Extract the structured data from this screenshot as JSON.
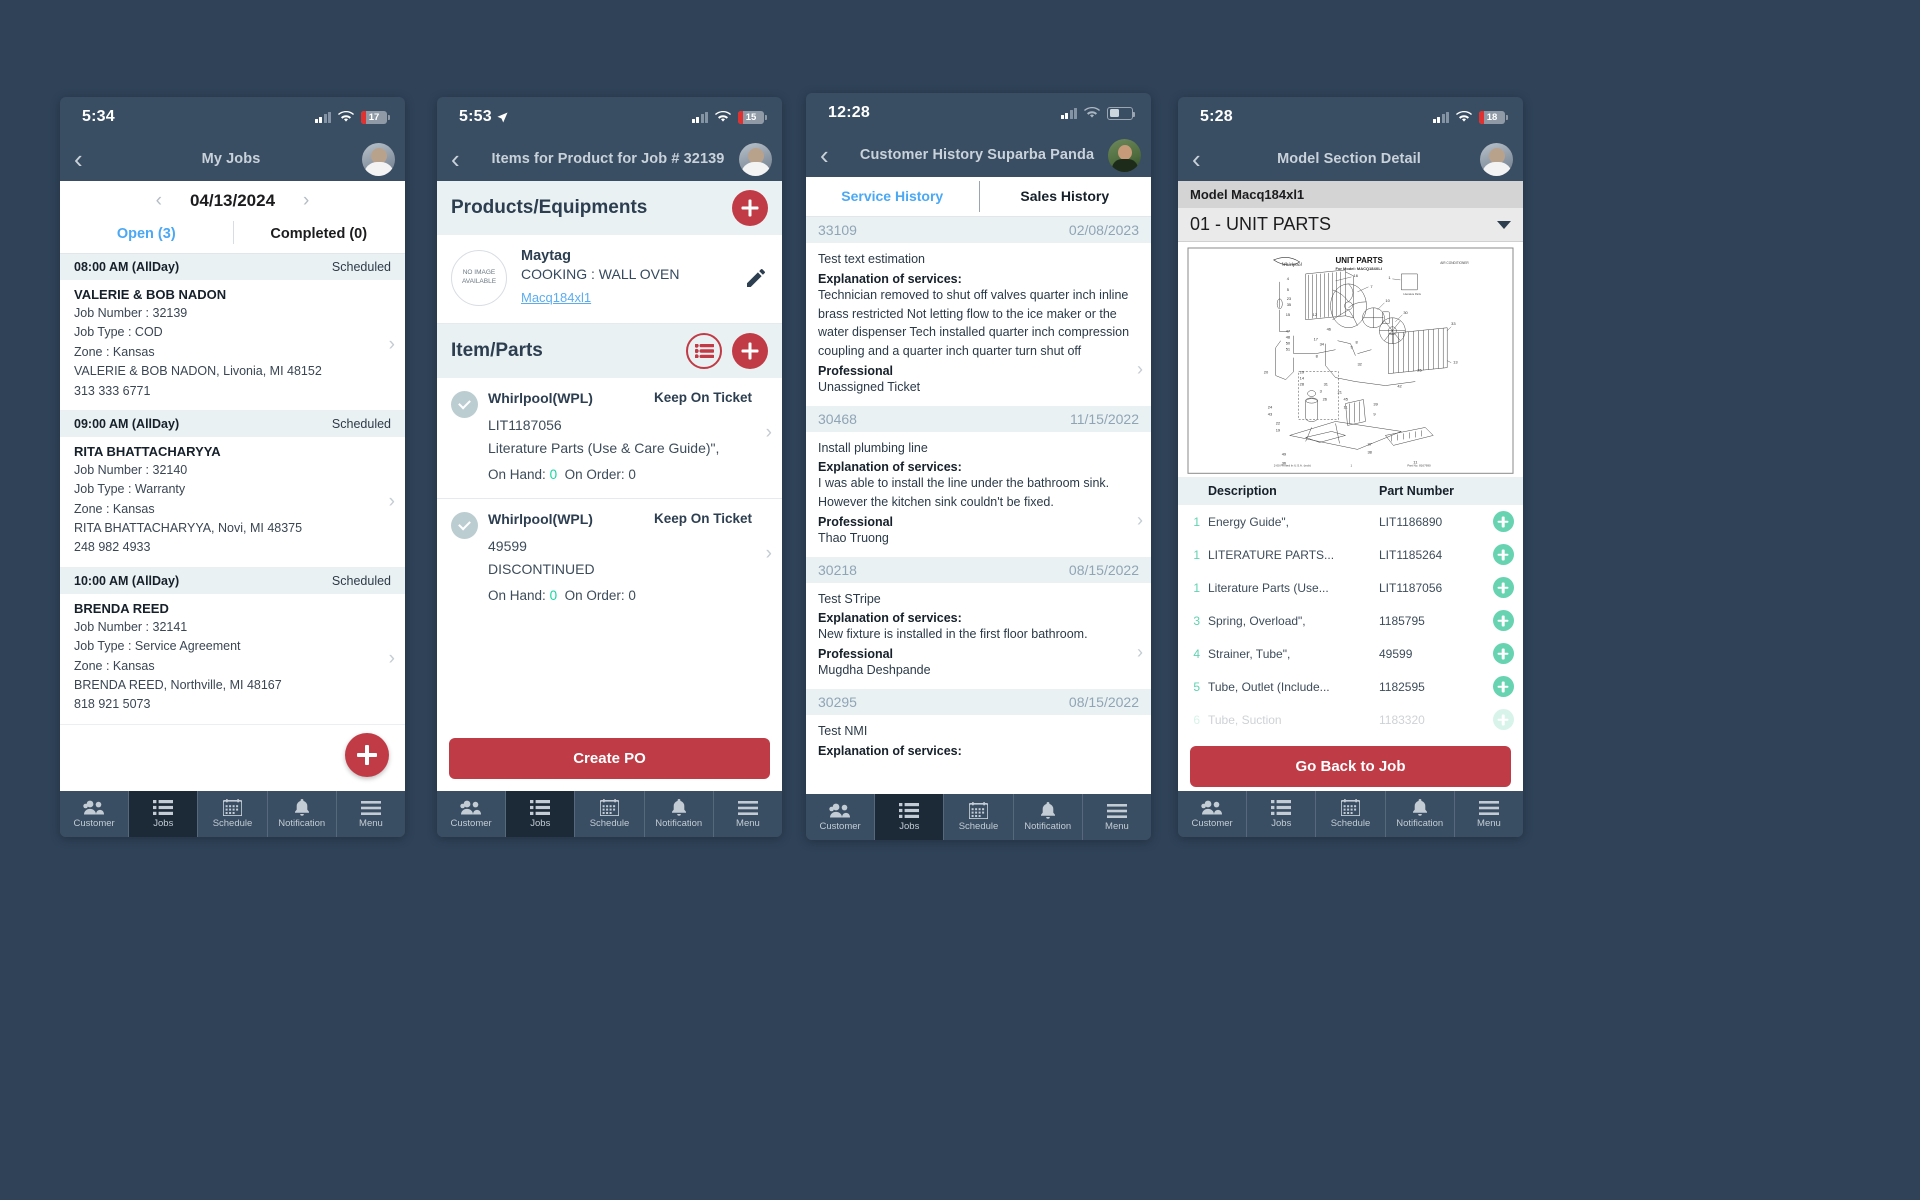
{
  "phone1": {
    "status": {
      "time": "5:34",
      "battery": "17"
    },
    "nav": {
      "back": "‹",
      "title": "My Jobs"
    },
    "date": {
      "prev": "‹",
      "value": "04/13/2024",
      "next": "›"
    },
    "segments": [
      {
        "label": "Open (3)",
        "active": true
      },
      {
        "label": "Completed (0)",
        "active": false
      }
    ],
    "jobs": [
      {
        "time": "08:00 AM (AllDay)",
        "status": "Scheduled",
        "name": "VALERIE & BOB NADON",
        "job_number": "Job Number : 32139",
        "job_type": "Job Type : COD",
        "zone": "Zone : Kansas",
        "address": "VALERIE & BOB NADON, Livonia, MI 48152",
        "phone": "313 333 6771"
      },
      {
        "time": "09:00 AM (AllDay)",
        "status": "Scheduled",
        "name": "RITA BHATTACHARYYA",
        "job_number": "Job Number : 32140",
        "job_type": "Job Type : Warranty",
        "zone": "Zone : Kansas",
        "address": "RITA BHATTACHARYYA, Novi, MI 48375",
        "phone": "248 982 4933"
      },
      {
        "time": "10:00 AM (AllDay)",
        "status": "Scheduled",
        "name": "BRENDA REED",
        "job_number": "Job Number : 32141",
        "job_type": "Job Type : Service Agreement",
        "zone": "Zone : Kansas",
        "address": "BRENDA REED, Northville, MI 48167",
        "phone": "818 921 5073"
      }
    ]
  },
  "phone2": {
    "status": {
      "time": "5:53",
      "battery": "15"
    },
    "nav": {
      "back": "‹",
      "title": "Items for Product for Job # 32139"
    },
    "products_section": {
      "title": "Products/Equipments",
      "add_label": "+"
    },
    "product": {
      "no_image": "NO IMAGE AVAILABLE",
      "brand": "Maytag",
      "category": "COOKING : WALL OVEN",
      "model": "Macq184xl1"
    },
    "parts_section": {
      "title": "Item/Parts"
    },
    "parts": [
      {
        "brand": "Whirlpool(WPL)",
        "keep": "Keep On Ticket",
        "part_number": "LIT1187056",
        "description": "Literature Parts (Use & Care Guide)\",",
        "on_hand_label": "On Hand:",
        "on_hand": "0",
        "on_order_label": "On Order:",
        "on_order": "0"
      },
      {
        "brand": "Whirlpool(WPL)",
        "keep": "Keep On Ticket",
        "part_number": "49599",
        "description": "DISCONTINUED",
        "on_hand_label": "On Hand:",
        "on_hand": "0",
        "on_order_label": "On Order:",
        "on_order": "0"
      }
    ],
    "create_po": "Create PO"
  },
  "phone3": {
    "status": {
      "time": "12:28"
    },
    "nav": {
      "back": "‹",
      "title": "Customer History Suparba Panda"
    },
    "tabs": [
      {
        "label": "Service History",
        "active": true
      },
      {
        "label": "Sales History",
        "active": false
      }
    ],
    "history": [
      {
        "id": "33109",
        "date": "02/08/2023",
        "summary": "Test text estimation",
        "explanation_label": "Explanation of services:",
        "explanation": "Technician removed to shut off valves quarter inch inline brass restricted Not letting flow to the ice maker or the water dispenser Tech installed quarter inch compression coupling and a quarter inch quarter turn shut off",
        "pro_label": "Professional",
        "pro_name": "Unassigned Ticket"
      },
      {
        "id": "30468",
        "date": "11/15/2022",
        "summary": "Install plumbing line",
        "explanation_label": "Explanation of services:",
        "explanation": "I was able to install the line under the bathroom sink. However the kitchen sink couldn't be fixed.",
        "pro_label": "Professional",
        "pro_name": "Thao Truong"
      },
      {
        "id": "30218",
        "date": "08/15/2022",
        "summary": "Test STripe",
        "explanation_label": "Explanation of services:",
        "explanation": "New fixture is installed in the first floor bathroom.",
        "pro_label": "Professional",
        "pro_name": "Mugdha Deshpande"
      },
      {
        "id": "30295",
        "date": "08/15/2022",
        "summary": "Test NMI",
        "explanation_label": "Explanation of services:",
        "explanation": "",
        "pro_label": "",
        "pro_name": ""
      }
    ]
  },
  "phone4": {
    "status": {
      "time": "5:28",
      "battery": "18"
    },
    "nav": {
      "back": "‹",
      "title": "Model Section Detail"
    },
    "model_bar": "Model Macq184xl1",
    "section": "01 - UNIT PARTS",
    "diagram": {
      "brand": "Whirlpool",
      "title": "UNIT PARTS",
      "subtitle": "For Model: MACQ184XLI",
      "corner_label": "AIR CONDITIONER",
      "footer_left": "2-00 Printed In U.S.A. (mdr)",
      "footer_center": "1",
      "footer_right": "Part No. 8167690",
      "callout": "Literature Parts"
    },
    "table": {
      "headers": {
        "description": "Description",
        "part_number": "Part Number"
      },
      "rows": [
        {
          "qty": "1",
          "description": "Energy Guide\",",
          "part_number": "LIT1186890"
        },
        {
          "qty": "1",
          "description": "LITERATURE PARTS...",
          "part_number": "LIT1185264"
        },
        {
          "qty": "1",
          "description": "Literature Parts (Use...",
          "part_number": "LIT1187056"
        },
        {
          "qty": "3",
          "description": "Spring, Overload\",",
          "part_number": "1185795"
        },
        {
          "qty": "4",
          "description": "Strainer, Tube\",",
          "part_number": "49599"
        },
        {
          "qty": "5",
          "description": "Tube, Outlet (Include...",
          "part_number": "1182595"
        },
        {
          "qty": "6",
          "description": "Tube, Suction",
          "part_number": "1183320"
        }
      ]
    },
    "go_back": "Go Back to Job"
  },
  "tabbar": {
    "items": [
      {
        "label": "Customer",
        "icon": "people-icon",
        "active": false
      },
      {
        "label": "Jobs",
        "icon": "list-icon",
        "active": true
      },
      {
        "label": "Schedule",
        "icon": "calendar-icon",
        "active": false
      },
      {
        "label": "Notification",
        "icon": "bell-icon",
        "active": false
      },
      {
        "label": "Menu",
        "icon": "hamburger-icon",
        "active": false
      }
    ]
  },
  "colors": {
    "chrome": "#3a4e63",
    "accent_red": "#c13b46",
    "accent_blue": "#4aa8f5",
    "accent_green": "#67d3b0"
  }
}
